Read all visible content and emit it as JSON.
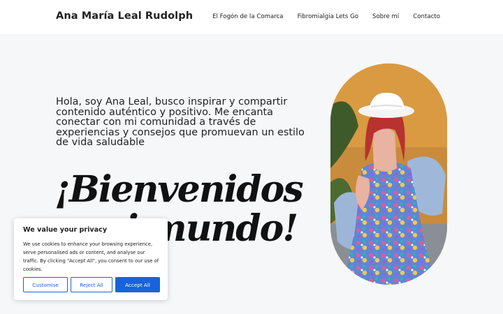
{
  "header": {
    "site_title": "Ana María Leal Rudolph",
    "nav": [
      {
        "label": "El Fogón de la Comarca"
      },
      {
        "label": "Fibromialgia Lets Go"
      },
      {
        "label": "Sobre mí"
      },
      {
        "label": "Contacto"
      }
    ]
  },
  "hero": {
    "intro": "Hola, soy Ana Leal, busco inspirar y compartir contenido auténtico y positivo. Me encanta conectar con mi comunidad a través de experiencias y consejos que promuevan un estilo de vida saludable",
    "headline": "¡Bienvenidos a mi mundo!"
  },
  "cookie_banner": {
    "title": "We value your privacy",
    "text": "We use cookies to enhance your browsing experience, serve personalised ads or content, and analyse our traffic. By clicking \"Accept All\", you consent to our use of cookies.",
    "customise_label": "Customise",
    "reject_label": "Reject All",
    "accept_label": "Accept All"
  },
  "colors": {
    "accent": "#1863dc",
    "background": "#f6f7f9",
    "header_bg": "#ffffff"
  }
}
